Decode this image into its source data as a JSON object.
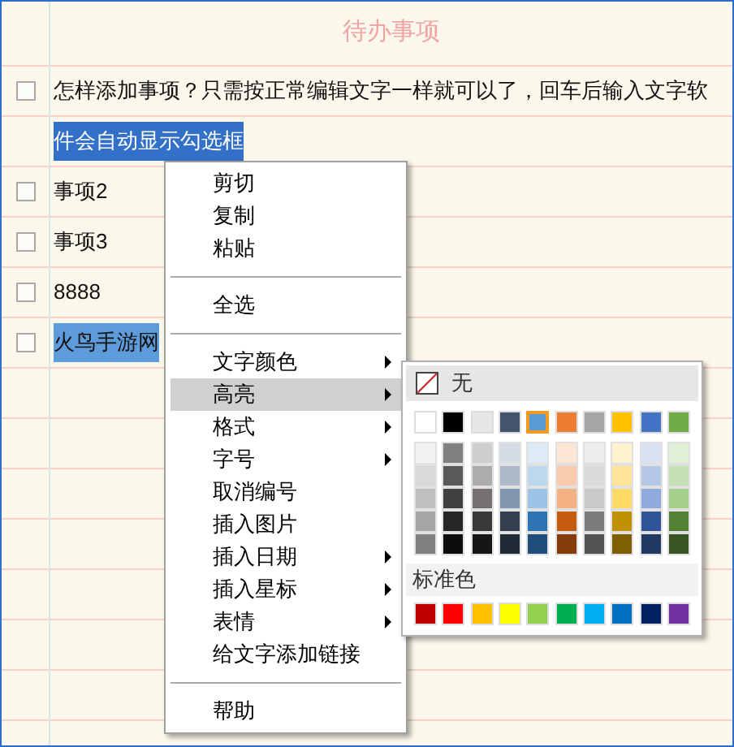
{
  "title": "待办事项",
  "rows": [
    {
      "kind": "task",
      "checked": false,
      "text": "怎样添加事项？只需按正常编辑文字一样就可以了，回车后输入文字软",
      "selected": false
    },
    {
      "kind": "continuation",
      "text": "件会自动显示勾选框",
      "selected": true,
      "active": true
    },
    {
      "kind": "task",
      "checked": false,
      "text": "事项2",
      "selected": false
    },
    {
      "kind": "task",
      "checked": false,
      "text": "事项3",
      "selected": false
    },
    {
      "kind": "task",
      "checked": false,
      "text": "8888",
      "selected": false
    },
    {
      "kind": "task",
      "checked": false,
      "text": "火鸟手游网",
      "selected": true,
      "active": false
    }
  ],
  "context_menu": [
    {
      "kind": "item",
      "label": "剪切",
      "submenu": false,
      "selected": false
    },
    {
      "kind": "item",
      "label": "复制",
      "submenu": false,
      "selected": false
    },
    {
      "kind": "item",
      "label": "粘贴",
      "submenu": false,
      "selected": false
    },
    {
      "kind": "separator"
    },
    {
      "kind": "item",
      "label": "全选",
      "submenu": false,
      "selected": false
    },
    {
      "kind": "separator"
    },
    {
      "kind": "item",
      "label": "文字颜色",
      "submenu": true,
      "selected": false
    },
    {
      "kind": "item",
      "label": "高亮",
      "submenu": true,
      "selected": true
    },
    {
      "kind": "item",
      "label": "格式",
      "submenu": true,
      "selected": false
    },
    {
      "kind": "item",
      "label": "字号",
      "submenu": true,
      "selected": false
    },
    {
      "kind": "item",
      "label": "取消编号",
      "submenu": false,
      "selected": false
    },
    {
      "kind": "item",
      "label": "插入图片",
      "submenu": false,
      "selected": false
    },
    {
      "kind": "item",
      "label": "插入日期",
      "submenu": true,
      "selected": false
    },
    {
      "kind": "item",
      "label": "插入星标",
      "submenu": true,
      "selected": false
    },
    {
      "kind": "item",
      "label": "表情",
      "submenu": true,
      "selected": false
    },
    {
      "kind": "item",
      "label": "给文字添加链接",
      "submenu": false,
      "selected": false
    },
    {
      "kind": "separator"
    },
    {
      "kind": "item",
      "label": "帮助",
      "submenu": false,
      "selected": false
    }
  ],
  "highlight_menu": {
    "none_label": "无",
    "theme_colors": [
      {
        "color": "#ffffff",
        "selected": false,
        "shades": [
          {
            "color": "#f2f2f2"
          },
          {
            "color": "#d9d9d9"
          },
          {
            "color": "#bfbfbf"
          },
          {
            "color": "#a6a6a6"
          },
          {
            "color": "#808080"
          }
        ]
      },
      {
        "color": "#000000",
        "selected": false,
        "shades": [
          {
            "color": "#808080"
          },
          {
            "color": "#595959"
          },
          {
            "color": "#404040"
          },
          {
            "color": "#262626"
          },
          {
            "color": "#0d0d0d"
          }
        ]
      },
      {
        "color": "#e7e6e6",
        "selected": false,
        "shades": [
          {
            "color": "#d0cece"
          },
          {
            "color": "#aeabab"
          },
          {
            "color": "#757171"
          },
          {
            "color": "#3a3838"
          },
          {
            "color": "#171616"
          }
        ]
      },
      {
        "color": "#44546a",
        "selected": false,
        "shades": [
          {
            "color": "#d6dce4"
          },
          {
            "color": "#adb9ca"
          },
          {
            "color": "#8497b0"
          },
          {
            "color": "#333f4f"
          },
          {
            "color": "#222b35"
          }
        ]
      },
      {
        "color": "#5b9bd5",
        "selected": true,
        "shades": [
          {
            "color": "#deebf6"
          },
          {
            "color": "#bdd7ee"
          },
          {
            "color": "#9dc3e6"
          },
          {
            "color": "#2e75b5"
          },
          {
            "color": "#1f4e79"
          }
        ]
      },
      {
        "color": "#ed7d31",
        "selected": false,
        "shades": [
          {
            "color": "#fbe5d5"
          },
          {
            "color": "#f7cbac"
          },
          {
            "color": "#f4b183"
          },
          {
            "color": "#c55a11"
          },
          {
            "color": "#843c0b"
          }
        ]
      },
      {
        "color": "#a5a5a5",
        "selected": false,
        "shades": [
          {
            "color": "#ededed"
          },
          {
            "color": "#dbdbdb"
          },
          {
            "color": "#c9c9c9"
          },
          {
            "color": "#7b7b7b"
          },
          {
            "color": "#525252"
          }
        ]
      },
      {
        "color": "#ffc000",
        "selected": false,
        "shades": [
          {
            "color": "#fff2cc"
          },
          {
            "color": "#fee599"
          },
          {
            "color": "#ffd965"
          },
          {
            "color": "#bf9000"
          },
          {
            "color": "#7f6000"
          }
        ]
      },
      {
        "color": "#4472c4",
        "selected": false,
        "shades": [
          {
            "color": "#dae3f3"
          },
          {
            "color": "#b4c7e7"
          },
          {
            "color": "#8faadc"
          },
          {
            "color": "#2f5597"
          },
          {
            "color": "#1f3864"
          }
        ]
      },
      {
        "color": "#70ad47",
        "selected": false,
        "shades": [
          {
            "color": "#e2efd9"
          },
          {
            "color": "#c5e0b3"
          },
          {
            "color": "#a8d08d"
          },
          {
            "color": "#538135"
          },
          {
            "color": "#375623"
          }
        ]
      }
    ],
    "standard_label": "标准色",
    "standard_colors": [
      {
        "color": "#c00000"
      },
      {
        "color": "#ff0000"
      },
      {
        "color": "#ffc000"
      },
      {
        "color": "#ffff00"
      },
      {
        "color": "#92d050"
      },
      {
        "color": "#00b050"
      },
      {
        "color": "#00b0f0"
      },
      {
        "color": "#0070c0"
      },
      {
        "color": "#002060"
      },
      {
        "color": "#7030a0"
      }
    ]
  }
}
